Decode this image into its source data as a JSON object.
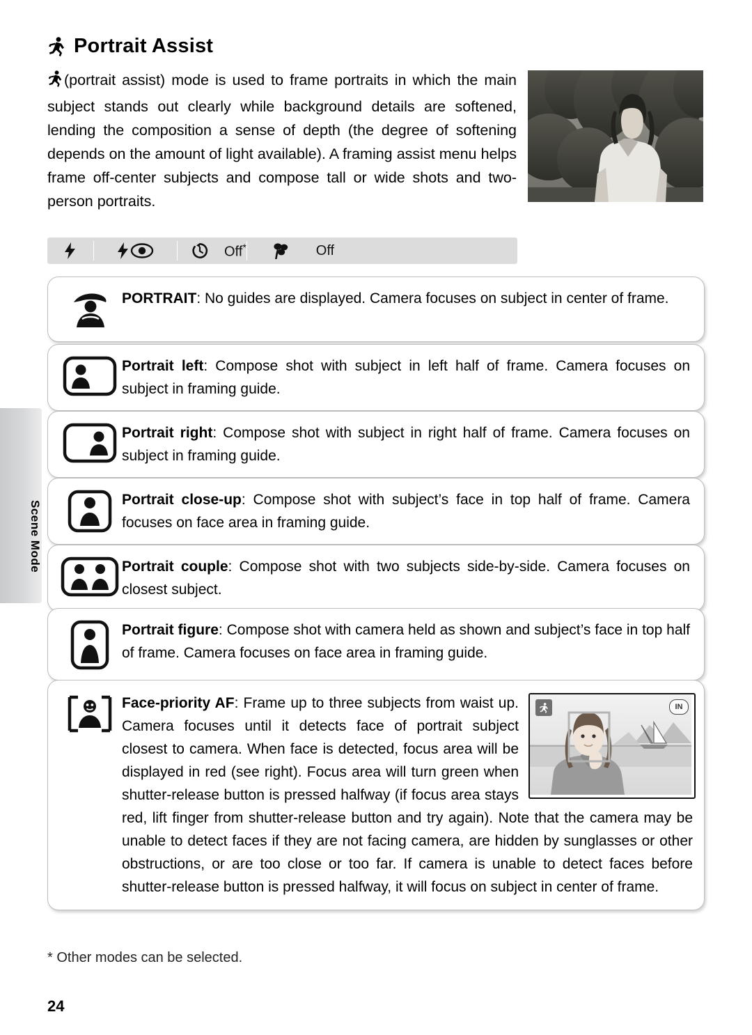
{
  "page": {
    "number": "24",
    "side_tab_label": "Scene Mode",
    "footnote": "* Other modes can be selected."
  },
  "heading": {
    "icon": "portrait-assist-runner-icon",
    "title": "Portrait Assist"
  },
  "intro": {
    "text": "(portrait assist) mode is used to frame portraits in which the main subject stands out clearly while background details are softened, lending the composition a sense of depth (the degree of softening depends on the amount of light available).  A framing assist menu helps frame off-center subjects and compose tall or wide shots and two-person portraits."
  },
  "photo": {
    "alt": "woman in white vest standing outdoors in front of trees"
  },
  "mode_bar": {
    "items": [
      {
        "icon": "flash-icon",
        "label": ""
      },
      {
        "icon": "flash-red-eye-icon",
        "label": ""
      },
      {
        "icon": "self-timer-icon",
        "label": "Off",
        "note": "*"
      },
      {
        "icon": "macro-flower-icon",
        "label": "Off"
      }
    ]
  },
  "guides": [
    {
      "icon": "portrait-person-hat-icon",
      "title": "PORTRAIT",
      "title_style": "caps",
      "body": ": No guides are displayed.  Camera focuses on subject in center of frame."
    },
    {
      "icon": "portrait-left-icon",
      "title": "Portrait left",
      "body": ": Compose shot with subject in left half of frame.  Camera focuses on subject in framing guide."
    },
    {
      "icon": "portrait-right-icon",
      "title": "Portrait right",
      "body": ": Compose shot with subject in right half of frame.  Camera focuses on subject in framing guide."
    },
    {
      "icon": "portrait-close-up-icon",
      "title": "Portrait close-up",
      "body": ": Compose shot with subject’s face in top half of frame.  Camera focuses on face area in framing guide."
    },
    {
      "icon": "portrait-couple-icon",
      "title": "Portrait couple",
      "body": ": Compose shot with two subjects side-by-side.  Camera focuses on closest subject."
    },
    {
      "icon": "portrait-figure-icon",
      "title": "Portrait figure",
      "body": ": Compose shot with camera held as shown and subject’s face in top half of frame.  Camera focuses on face area in framing guide."
    }
  ],
  "face_priority": {
    "icon": "face-priority-af-icon",
    "title": "Face-priority AF",
    "body": ": Frame up to three subjects from waist up.  Camera focuses until it detects face of portrait subject closest to camera.  When face is detected, focus area will be displayed in red (see right).  Focus area will turn green when shutter-release button is pressed halfway (if focus area stays red, lift finger from shutter-release button and try again).  Note that the camera may be unable to detect faces if they are not facing camera, are hidden by sunglasses or other obstructions, or are too close or too far.  If camera is unable to detect faces before shutter-release button is pressed halfway, it will focus on subject in center of frame.",
    "screen": {
      "mode_badge": "portrait-assist-runner-icon",
      "battery_badge": "IN",
      "focus_frame_color": "#b4b4b4"
    }
  }
}
